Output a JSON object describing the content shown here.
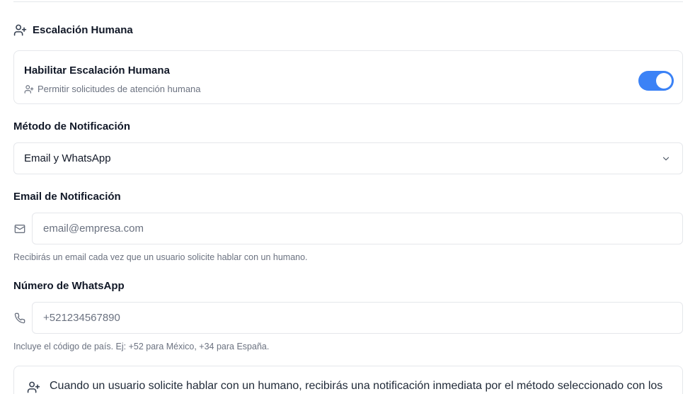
{
  "section": {
    "title": "Escalación Humana",
    "icon": "user-plus-icon"
  },
  "toggle": {
    "title": "Habilitar Escalación Humana",
    "description": "Permitir solicitudes de atención humana",
    "enabled": true,
    "color": "#3b82f6"
  },
  "notification_method": {
    "label": "Método de Notificación",
    "selected": "Email y WhatsApp"
  },
  "email": {
    "label": "Email de Notificación",
    "value": "",
    "placeholder": "email@empresa.com",
    "help": "Recibirás un email cada vez que un usuario solicite hablar con un humano.",
    "icon": "mail-icon"
  },
  "whatsapp": {
    "label": "Número de WhatsApp",
    "value": "",
    "placeholder": "+521234567890",
    "help": "Incluye el código de país. Ej: +52 para México, +34 para España.",
    "icon": "phone-icon"
  },
  "info": {
    "text": "Cuando un usuario solicite hablar con un humano, recibirás una notificación inmediata por el método seleccionado con los"
  }
}
